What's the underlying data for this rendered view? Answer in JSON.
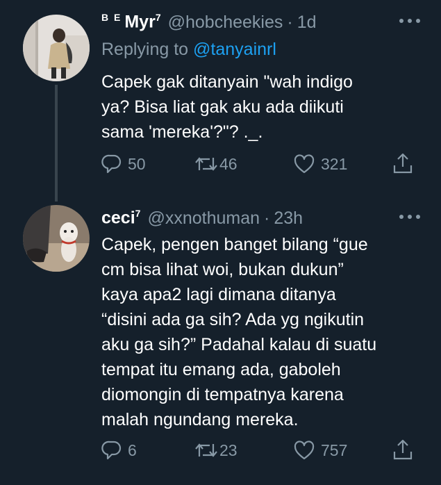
{
  "tweets": [
    {
      "name": "Myr",
      "name_prefix": "B E",
      "name_suffix": "7",
      "handle": "@hobcheekies",
      "separator": "·",
      "time": "1d",
      "replying_label": "Replying to",
      "replying_handle": "@tanyainrl",
      "text": "Capek gak ditanyain \"wah indigo\nya? Bisa liat gak aku ada diikuti\nsama 'mereka'?\"? ._.",
      "reply_count": "50",
      "retweet_count": "46",
      "like_count": "321",
      "icons": [
        "reply-icon",
        "retweet-icon",
        "like-icon",
        "share-icon",
        "more-icon"
      ]
    },
    {
      "name": "ceci",
      "name_suffix": "7",
      "handle": "@xxnothuman",
      "separator": "·",
      "time": "23h",
      "text": "Capek, pengen banget bilang “gue\ncm bisa lihat woi, bukan dukun”\nkaya apa2 lagi dimana ditanya\n“disini ada ga sih? Ada yg ngikutin\naku ga sih?” Padahal kalau di suatu\ntempat itu emang ada, gaboleh\ndiomongin di tempatnya karena\nmalah ngundang mereka.",
      "reply_count": "6",
      "retweet_count": "23",
      "like_count": "757",
      "icons": [
        "reply-icon",
        "retweet-icon",
        "like-icon",
        "share-icon",
        "more-icon"
      ]
    }
  ],
  "colors": {
    "background": "#15202b",
    "text": "#ffffff",
    "muted": "#8899a6",
    "link": "#1da1f2",
    "thread_line": "#38444d"
  }
}
